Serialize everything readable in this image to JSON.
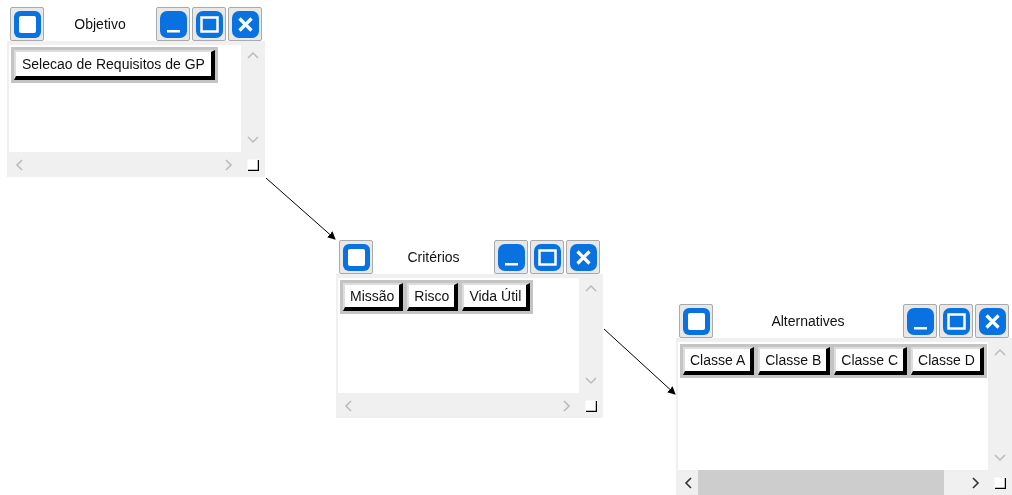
{
  "windows": [
    {
      "title": "Objetivo",
      "items": [
        "Selecao de Requisitos de GP"
      ],
      "scroll_thumb": false
    },
    {
      "title": "Critérios",
      "items": [
        "Missão",
        "Risco",
        "Vida Útil"
      ],
      "scroll_thumb": false
    },
    {
      "title": "Alternatives",
      "items": [
        "Classe A",
        "Classe B",
        "Classe C",
        "Classe D"
      ],
      "scroll_thumb": true
    }
  ]
}
